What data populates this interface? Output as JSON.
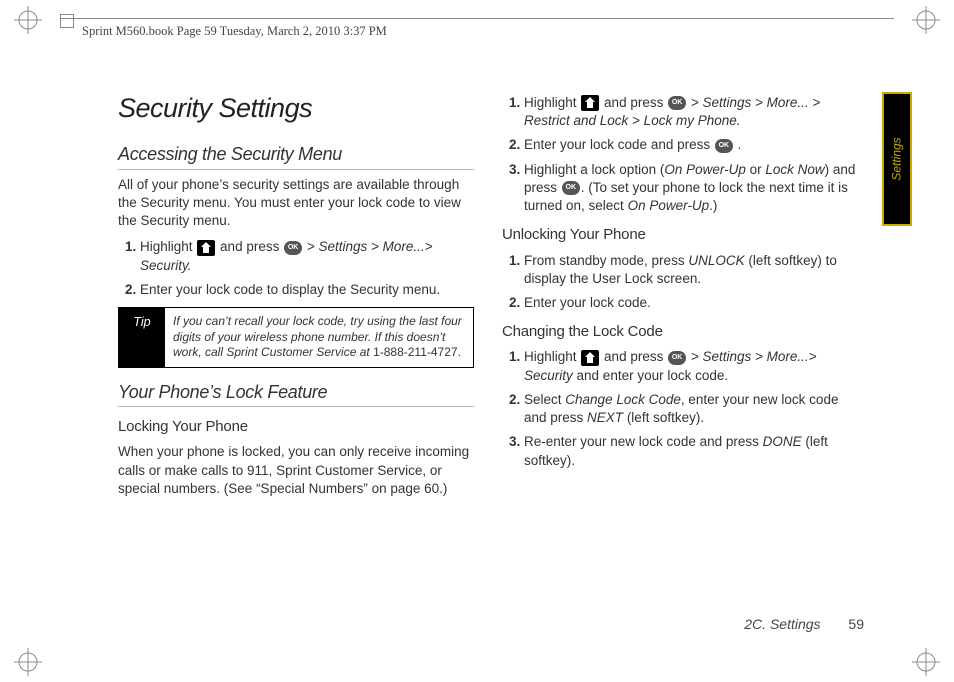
{
  "header": {
    "text": "Sprint M560.book  Page 59  Tuesday, March 2, 2010  3:37 PM"
  },
  "sideTab": "Settings",
  "title": "Security Settings",
  "left": {
    "h2_accessing": "Accessing the Security Menu",
    "p_intro": "All of your phone’s security settings are available through the Security menu. You must enter your lock code to view the Security menu.",
    "step1_a": "Highlight ",
    "step1_b": " and press ",
    "step1_c": " > Settings > More...> Security.",
    "step2": "Enter your lock code to display the Security menu.",
    "tip_label": "Tip",
    "tip_body": "If you can’t recall your lock code, try using the last four digits of your wireless phone number. If this doesn’t work, call Sprint Customer Service at ",
    "tip_phone": "1-888-211-4727.",
    "h2_lock": "Your Phone’s Lock Feature",
    "h3_locking": "Locking Your Phone",
    "p_locking": "When your phone is locked, you can only receive incoming calls or make calls to 911, Sprint Customer Service, or special numbers. (See “Special Numbers” on page 60.)"
  },
  "right": {
    "r1_a": "Highlight ",
    "r1_b": " and press ",
    "r1_c": " > Settings > More... > Restrict and Lock",
    "r1_d": " > Lock my Phone.",
    "r2_a": "Enter your lock code and press ",
    "r2_b": ".",
    "r3_a": "Highlight a lock option (",
    "r3_opt1": "On Power-Up",
    "r3_or": " or ",
    "r3_opt2": "Lock Now",
    "r3_b": ") and press ",
    "r3_c": ". (To set your phone to lock the next time it is turned on, select ",
    "r3_opt3": "On Power-Up",
    "r3_d": ".)",
    "h3_unlock": "Unlocking Your Phone",
    "u1_a": "From standby mode, press ",
    "u1_key": "UNLOCK",
    "u1_b": " (left softkey) to display the User Lock screen.",
    "u2": "Enter your lock code.",
    "h3_change": "Changing the Lock Code",
    "c1_a": "Highlight ",
    "c1_b": " and press ",
    "c1_c": " > Settings > More...> Security",
    "c1_d": " and enter your lock code.",
    "c2_a": "Select ",
    "c2_key": "Change Lock Code",
    "c2_b": ", enter your new lock code and press ",
    "c2_key2": "NEXT",
    "c2_c": " (left softkey).",
    "c3_a": "Re-enter your new lock code and press ",
    "c3_key": "DONE",
    "c3_b": " (left softkey)."
  },
  "footer": {
    "section": "2C. Settings",
    "page": "59"
  }
}
